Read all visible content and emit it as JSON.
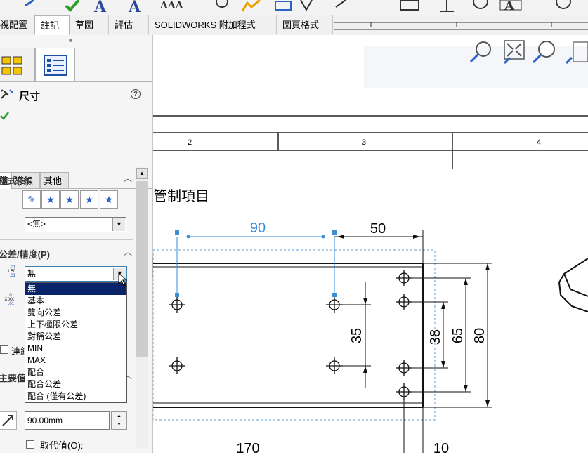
{
  "tabs": [
    "視配置",
    "註記",
    "草圖",
    "評估",
    "SOLIDWORKS 附加程式",
    "圖頁格式"
  ],
  "active_tab_index": 1,
  "property_manager": {
    "title": "尺寸",
    "help_symbol": "?",
    "subtabs": [
      "值",
      "導線",
      "其他"
    ],
    "style_group": "樣式(S)",
    "style_value": "<無>",
    "tolerance_group": "公差/精度(P)",
    "tolerance_value": "無",
    "tolerance_options": [
      "無",
      "基本",
      "雙向公差",
      "上下極限公差",
      "對稱公差",
      "MIN",
      "MAX",
      "配合",
      "配合公差",
      "配合 (僅有公差)"
    ],
    "selected_option_index": 0,
    "primary_group": "主要值",
    "link_label": "連結",
    "value_field": "90.00mm",
    "override_label": "取代值(O):",
    "tol_preview_a": [
      ".01",
      "1.50",
      ".01"
    ],
    "tol_preview_b": [
      ".01",
      "X.XX",
      ".01"
    ]
  },
  "drawing": {
    "zone_numbers": [
      "2",
      "3",
      "4"
    ],
    "note_title": "管制項目",
    "dimensions": {
      "d90": "90",
      "d50": "50",
      "d35": "35",
      "d38": "38",
      "d65": "65",
      "d80": "80",
      "d170": "170",
      "d10": "10"
    }
  },
  "colors": {
    "selected_dim": "#3a8fd8",
    "highlight": "#0a246a",
    "tab_bg": "#f0f0f0"
  }
}
